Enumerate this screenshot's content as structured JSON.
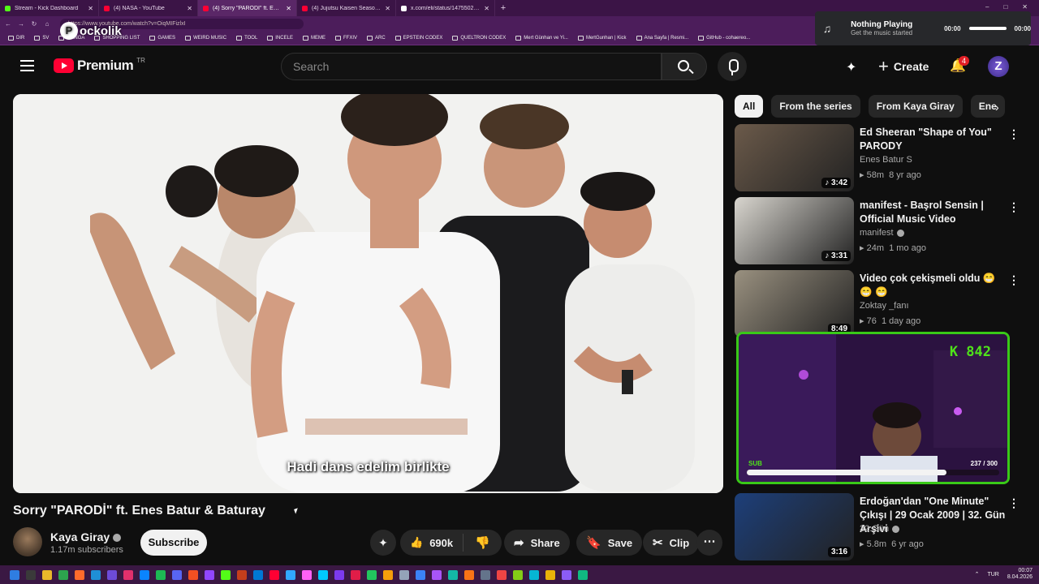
{
  "browser": {
    "tabs": [
      {
        "title": "Stream - Kick Dashboard",
        "color": "#53fc18",
        "active": false
      },
      {
        "title": "(4) NASA - YouTube",
        "color": "#ff0033",
        "active": false
      },
      {
        "title": "(4) Sorry \"PARODİ\" ft. Enes B...",
        "color": "#ff0033",
        "active": true
      },
      {
        "title": "(4) Jujutsu Kaisen Season 2 OST -",
        "color": "#ff0033",
        "active": false
      },
      {
        "title": "x.com/eli/status/1475502807251...",
        "color": "#ffffff",
        "active": false
      }
    ],
    "new_tab": "+",
    "url": "https://www.youtube.com/watch?v=OiqMIFizlxI",
    "bookmarks": [
      "DIR",
      "SV",
      "MANGA",
      "SHOPPING LIST",
      "GAMES",
      "WEIRD MUSIC",
      "TOOL",
      "INCELE",
      "MEME",
      "FFXIV",
      "ARC",
      "EPSTEIN CODEX",
      "QUELTRON CODEX",
      "Mert Günhan ve Yi...",
      "MertGunhan | Kick",
      "Ana Sayfa | Resmi...",
      "GitHub - cohaereo..."
    ],
    "window_controls": [
      "–",
      "□",
      "✕"
    ]
  },
  "overlay_logo": "ockolik",
  "music_widget": {
    "title": "Nothing Playing",
    "subtitle": "Get the music started",
    "time_start": "00:00",
    "time_end": "00:00"
  },
  "header": {
    "brand": "Premium",
    "region": "TR",
    "search_placeholder": "Search",
    "create_label": "Create",
    "notification_count": "4",
    "avatar_letter": "Z"
  },
  "video": {
    "caption": "Hadi dans edelim birlikte",
    "title": "Sorry \"PARODİ\" ft. Enes Batur & Baturay"
  },
  "channel": {
    "name": "Kaya Giray",
    "subscribers": "1.17m subscribers",
    "subscribe_label": "Subscribe",
    "likes": "690k",
    "share_label": "Share",
    "save_label": "Save",
    "clip_label": "Clip"
  },
  "chips": [
    "All",
    "From the series",
    "From Kaya Giray",
    "Ene"
  ],
  "recommendations": [
    {
      "title": "Ed Sheeran \"Shape of You\" PARODY",
      "channel": "Enes Batur S",
      "verified": false,
      "views": "58m",
      "age": "8 yr ago",
      "duration": "3:42",
      "music": true,
      "thumb_color": "#6b5a4a"
    },
    {
      "title": "manifest - Başrol Sensin | Official Music Video",
      "channel": "manifest",
      "verified": true,
      "views": "24m",
      "age": "1 mo ago",
      "duration": "3:31",
      "music": true,
      "thumb_color": "#d9d6cf"
    },
    {
      "title": "Video çok çekişmeli oldu 😁😁 😁",
      "channel": "Zoktay _fanı",
      "verified": false,
      "views": "76",
      "age": "1 day ago",
      "duration": "8:49",
      "music": false,
      "thumb_color": "#9a9180"
    },
    {
      "title": "Erdoğan'dan \"One Minute\" Çıkışı | 29 Ocak 2009 | 32. Gün Arşivi",
      "channel": "32.Gün",
      "verified": true,
      "views": "5.8m",
      "age": "6 yr ago",
      "duration": "3:16",
      "music": false,
      "thumb_color": "#1d3f7a"
    }
  ],
  "stream_overlay": {
    "counter": "K 842",
    "sub_label": "SUB",
    "sub_progress": "237 / 300",
    "sub_fraction": 0.79
  },
  "taskbar": {
    "lang": "TUR",
    "time": "00:07",
    "date": "8.04.2026"
  }
}
